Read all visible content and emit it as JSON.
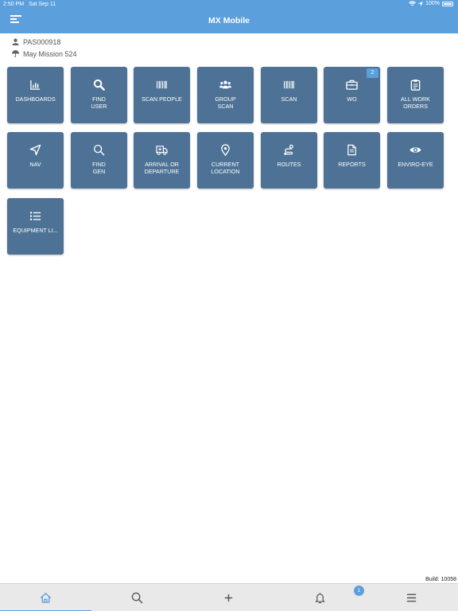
{
  "status_bar": {
    "time": "2:50 PM",
    "date": "Sat Sep 11",
    "battery": "100%"
  },
  "header": {
    "title": "MX Mobile"
  },
  "user": {
    "id": "PAS000918",
    "mission": "May Mission 524"
  },
  "tiles": [
    {
      "label": "DASHBOARDS",
      "icon": "chart-icon"
    },
    {
      "label": "FIND\nUSER",
      "icon": "search-icon"
    },
    {
      "label": "SCAN PEOPLE",
      "icon": "barcode-icon"
    },
    {
      "label": "GROUP\nSCAN",
      "icon": "group-icon"
    },
    {
      "label": "SCAN",
      "icon": "barcode-icon"
    },
    {
      "label": "WO",
      "icon": "briefcase-icon",
      "badge": "2"
    },
    {
      "label": "ALL WORK\nORDERS",
      "icon": "clipboard-icon"
    },
    {
      "label": "NAV",
      "icon": "navigation-arrow-icon"
    },
    {
      "label": "FIND\nGEN",
      "icon": "search-icon"
    },
    {
      "label": "ARRIVAL OR\nDEPARTURE",
      "icon": "truck-icon"
    },
    {
      "label": "CURRENT\nLOCATION",
      "icon": "map-pin-icon"
    },
    {
      "label": "ROUTES",
      "icon": "route-icon"
    },
    {
      "label": "REPORTS",
      "icon": "document-icon"
    },
    {
      "label": "ENVIRO-EYE",
      "icon": "eye-icon"
    },
    {
      "label": "EQUIPMENT LI...",
      "icon": "list-icon"
    }
  ],
  "footer": {
    "build": "Build: 10058"
  },
  "tabbar": {
    "tabs": [
      {
        "name": "home",
        "icon": "home-icon"
      },
      {
        "name": "search",
        "icon": "search-icon"
      },
      {
        "name": "add",
        "icon": "plus-icon"
      },
      {
        "name": "notifications",
        "icon": "bell-icon"
      },
      {
        "name": "menu",
        "icon": "hamburger-icon"
      }
    ],
    "notification_count": "1"
  },
  "colors": {
    "accent": "#5b9fdd",
    "tile": "#4d7295"
  }
}
